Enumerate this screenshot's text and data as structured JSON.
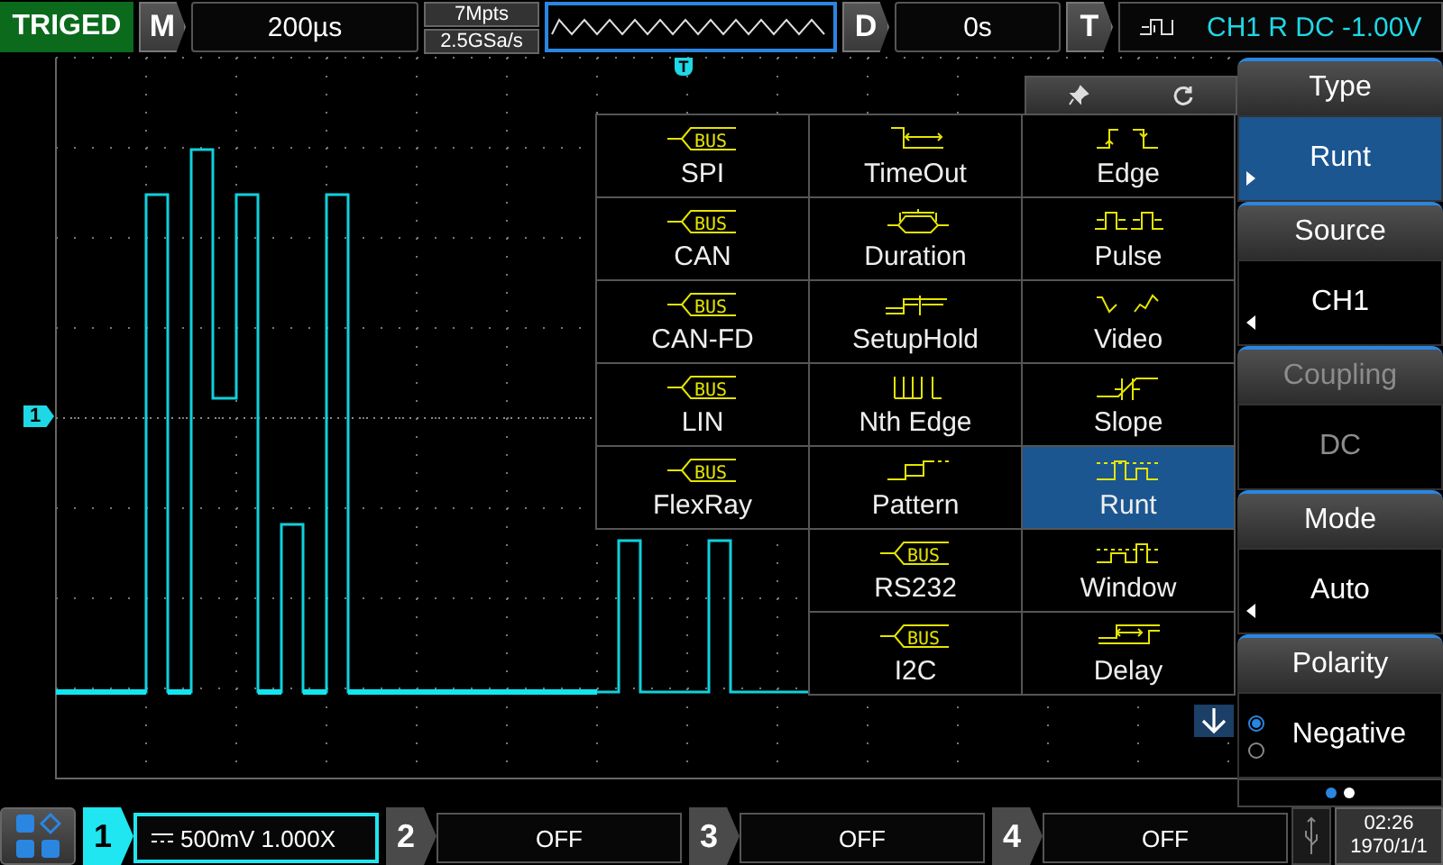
{
  "status": {
    "text": "TRIGED"
  },
  "timebase": {
    "label": "M",
    "value": "200µs"
  },
  "acquisition": {
    "depth": "7Mpts",
    "sample_rate": "2.5GSa/s"
  },
  "delay": {
    "label": "D",
    "value": "0s"
  },
  "trigger": {
    "label": "T",
    "readout": "CH1 R DC -1.00V"
  },
  "markers": {
    "channel": "1",
    "trigger": "T"
  },
  "trigger_type_menu": {
    "columns": [
      [
        {
          "label": "SPI",
          "kind": "bus",
          "icon_text": "BUS",
          "selected": false
        },
        {
          "label": "CAN",
          "kind": "bus",
          "icon_text": "BUS",
          "selected": false
        },
        {
          "label": "CAN-FD",
          "kind": "bus",
          "icon_text": "BUS",
          "selected": false
        },
        {
          "label": "LIN",
          "kind": "bus",
          "icon_text": "BUS",
          "selected": false
        },
        {
          "label": "FlexRay",
          "kind": "bus",
          "icon_text": "BUS",
          "selected": false
        }
      ],
      [
        {
          "label": "TimeOut",
          "kind": "timeout",
          "selected": false
        },
        {
          "label": "Duration",
          "kind": "duration",
          "selected": false
        },
        {
          "label": "SetupHold",
          "kind": "setuphold",
          "selected": false
        },
        {
          "label": "Nth Edge",
          "kind": "nthedge",
          "selected": false
        },
        {
          "label": "Pattern",
          "kind": "pattern",
          "selected": false
        },
        {
          "label": "RS232",
          "kind": "bus",
          "icon_text": "BUS",
          "selected": false
        },
        {
          "label": "I2C",
          "kind": "bus",
          "icon_text": "BUS",
          "selected": false
        }
      ],
      [
        {
          "label": "Edge",
          "kind": "edge",
          "selected": false
        },
        {
          "label": "Pulse",
          "kind": "pulse",
          "selected": false
        },
        {
          "label": "Video",
          "kind": "video",
          "selected": false
        },
        {
          "label": "Slope",
          "kind": "slope",
          "selected": false
        },
        {
          "label": "Runt",
          "kind": "runt",
          "selected": true
        },
        {
          "label": "Window",
          "kind": "window",
          "selected": false
        },
        {
          "label": "Delay",
          "kind": "delay",
          "selected": false
        }
      ]
    ]
  },
  "side_menu": [
    {
      "title": "Type",
      "value": "Runt",
      "kind": "select",
      "selected": true,
      "disabled": false
    },
    {
      "title": "Source",
      "value": "CH1",
      "kind": "select",
      "selected": false,
      "disabled": false
    },
    {
      "title": "Coupling",
      "value": "DC",
      "kind": "select",
      "selected": false,
      "disabled": true
    },
    {
      "title": "Mode",
      "value": "Auto",
      "kind": "select",
      "selected": false,
      "disabled": false
    },
    {
      "title": "Polarity",
      "value": "Negative",
      "kind": "radio",
      "selected": false,
      "disabled": false,
      "options": [
        {
          "selected": true
        },
        {
          "selected": false
        }
      ]
    }
  ],
  "page_dots": [
    {
      "selected": true
    },
    {
      "selected": false
    }
  ],
  "channels": [
    {
      "number": "1",
      "reading": "500mV 1.000X",
      "on": true
    },
    {
      "number": "2",
      "reading": "OFF",
      "on": false
    },
    {
      "number": "3",
      "reading": "OFF",
      "on": false
    },
    {
      "number": "4",
      "reading": "OFF",
      "on": false
    }
  ],
  "clock": {
    "time": "02:26",
    "date": "1970/1/1"
  }
}
